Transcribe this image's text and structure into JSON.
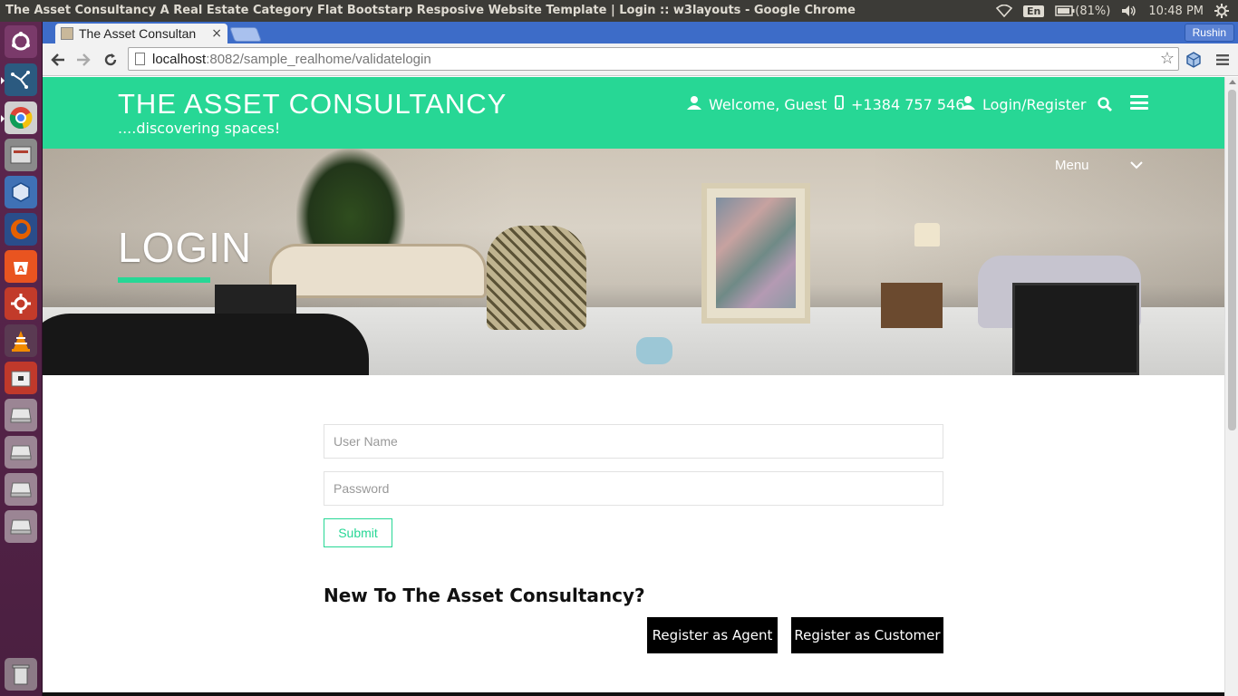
{
  "os_panel": {
    "window_title": "The Asset Consultancy A Real Estate Category Flat Bootstarp Resposive Website Template | Login :: w3layouts - Google Chrome",
    "keyboard_layout": "En",
    "battery": "(81%)",
    "clock": "10:48 PM"
  },
  "launcher": {
    "items": [
      "ubuntu-dash-icon",
      "mysql-workbench-icon",
      "chrome-icon",
      "files-icon",
      "virtualbox-icon",
      "firefox-icon",
      "software-center-icon",
      "system-settings-icon",
      "vlc-icon",
      "archive-manager-icon",
      "drive-icon",
      "drive-icon",
      "drive-icon",
      "drive-icon",
      "trash-icon"
    ]
  },
  "browser": {
    "tab_title": "The Asset Consultan",
    "tab_close": "×",
    "profile_name": "Rushin",
    "url_host": "localhost",
    "url_rest": ":8082/sample_realhome/validatelogin"
  },
  "header": {
    "brand": "THE ASSET CONSULTANCY",
    "tagline": "....discovering spaces!",
    "welcome": "Welcome, Guest",
    "phone": "+1384 757 546",
    "login_register": "Login/Register"
  },
  "hero": {
    "title": "LOGIN",
    "menu_label": "Menu"
  },
  "form": {
    "username_placeholder": "User Name",
    "password_placeholder": "Password",
    "submit_label": "Submit"
  },
  "register": {
    "heading": "New To The Asset Consultancy?",
    "agent_label": "Register as Agent",
    "customer_label": "Register as Customer"
  },
  "colors": {
    "accent": "#27d795",
    "launcher": "#5e2750",
    "tabstrip": "#3d6cc8"
  }
}
